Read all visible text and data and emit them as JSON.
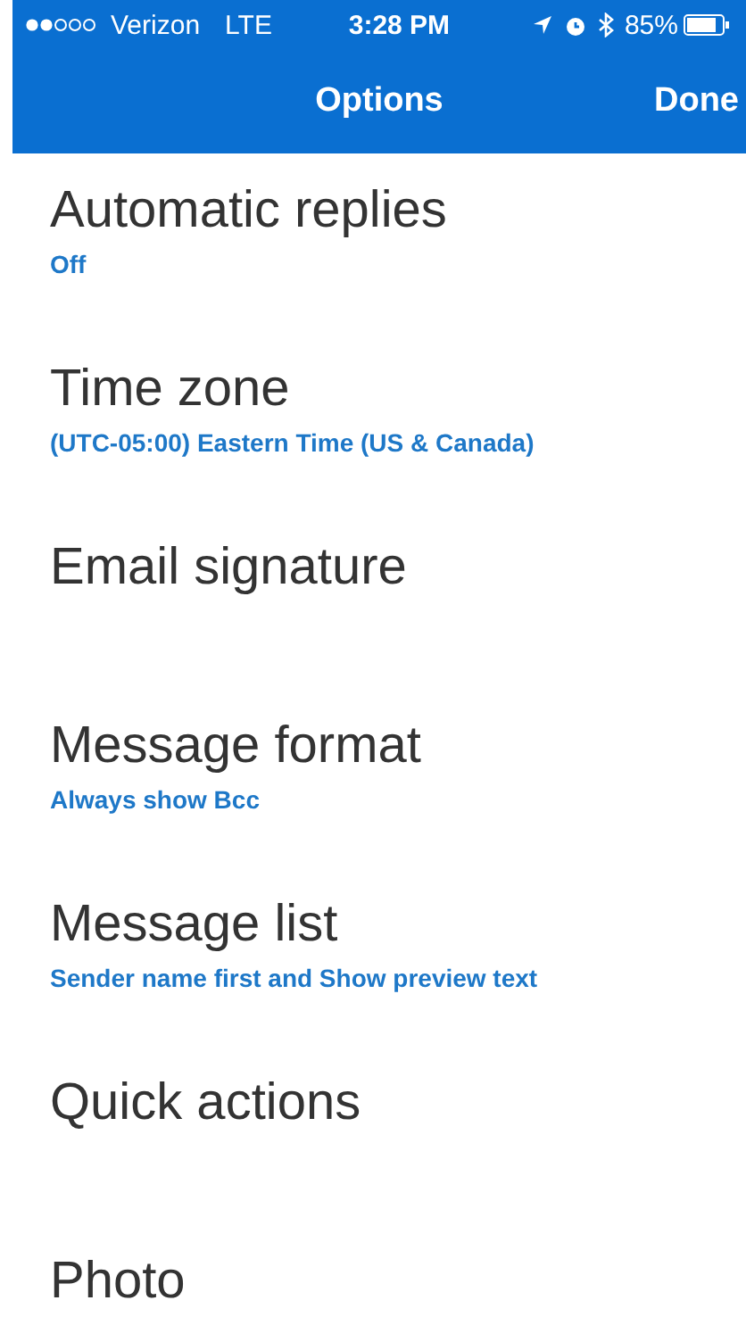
{
  "status_bar": {
    "carrier": "Verizon",
    "network": "LTE",
    "time": "3:28 PM",
    "battery": "85%"
  },
  "nav_bar": {
    "title": "Options",
    "action": "Done"
  },
  "settings": [
    {
      "title": "Automatic replies",
      "value": "Off"
    },
    {
      "title": "Time zone",
      "value": "(UTC-05:00) Eastern Time (US & Canada)"
    },
    {
      "title": "Email signature"
    },
    {
      "title": "Message format",
      "value": "Always show Bcc"
    },
    {
      "title": "Message list",
      "value": "Sender name first and Show preview text"
    },
    {
      "title": "Quick actions"
    },
    {
      "title": "Photo"
    }
  ]
}
